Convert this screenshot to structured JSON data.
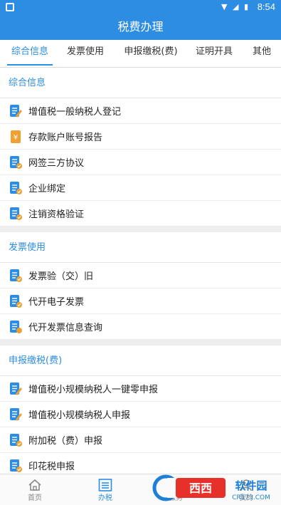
{
  "status_bar": {
    "time": "8:54",
    "icons": "▼ ◢ ▮"
  },
  "header": {
    "title": "税费办理"
  },
  "tabs": [
    {
      "label": "综合信息",
      "active": true
    },
    {
      "label": "发票使用",
      "active": false
    },
    {
      "label": "申报缴税(费)",
      "active": false
    },
    {
      "label": "证明开具",
      "active": false
    },
    {
      "label": "其他",
      "active": false
    }
  ],
  "sections": [
    {
      "title": "综合信息",
      "items": [
        {
          "label": "增值税一般纳税人登记",
          "icon": "document-edit-icon"
        },
        {
          "label": "存款账户账号报告",
          "icon": "yuan-document-icon"
        },
        {
          "label": "网签三方协议",
          "icon": "document-check-icon"
        },
        {
          "label": "企业绑定",
          "icon": "document-check-icon"
        },
        {
          "label": "注销资格验证",
          "icon": "document-check-icon"
        }
      ]
    },
    {
      "title": "发票使用",
      "items": [
        {
          "label": "发票验（交）旧",
          "icon": "document-check-icon"
        },
        {
          "label": "代开电子发票",
          "icon": "document-check-icon"
        },
        {
          "label": "代开发票信息查询",
          "icon": "document-search-icon"
        }
      ]
    },
    {
      "title": "申报缴税(费)",
      "items": [
        {
          "label": "增值税小规模纳税人一键零申报",
          "icon": "document-edit-icon"
        },
        {
          "label": "增值税小规模纳税人申报",
          "icon": "document-edit-icon"
        },
        {
          "label": "附加税（费）申报",
          "icon": "document-check-icon"
        },
        {
          "label": "印花税申报",
          "icon": "document-check-icon"
        }
      ]
    }
  ],
  "bottom_nav": [
    {
      "label": "首页",
      "icon": "home-icon",
      "active": false
    },
    {
      "label": "办税",
      "icon": "list-icon",
      "active": true
    },
    {
      "label": "服务",
      "icon": "service-icon",
      "active": false
    },
    {
      "label": "我的",
      "icon": "user-icon",
      "active": false
    }
  ],
  "watermark": {
    "text": "西西软件园",
    "url": "CR173.COM"
  },
  "colors": {
    "primary": "#2c8de3",
    "icon_orange": "#f0a030",
    "background": "#f0f0f0"
  }
}
